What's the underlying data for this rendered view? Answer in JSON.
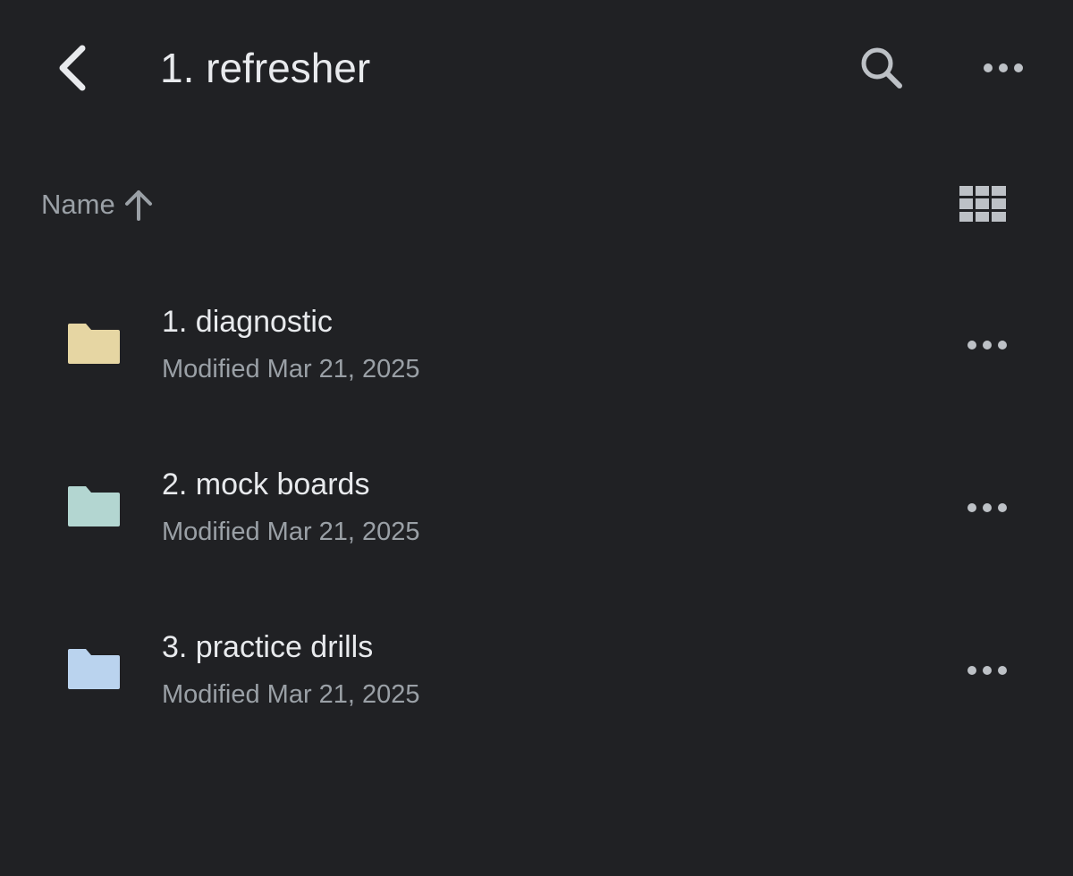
{
  "app_bar": {
    "title": "1. refresher",
    "back_icon": "chevron-left-icon",
    "search_icon": "search-icon",
    "more_icon": "more-horizontal-icon"
  },
  "toolbar": {
    "sort_label": "Name",
    "sort_icon": "arrow-up-icon",
    "view_icon": "grid-view-icon"
  },
  "items": [
    {
      "name": "1. diagnostic",
      "meta": "Modified Mar 21, 2025",
      "folder_color": "#e6d6a3",
      "icon": "folder-icon"
    },
    {
      "name": "2. mock boards",
      "meta": "Modified Mar 21, 2025",
      "folder_color": "#b3d6d1",
      "icon": "folder-icon"
    },
    {
      "name": "3. practice drills",
      "meta": "Modified Mar 21, 2025",
      "folder_color": "#bad3ee",
      "icon": "folder-icon"
    }
  ],
  "colors": {
    "background": "#202124",
    "primary_text": "#e8eaed",
    "secondary_text": "#9aa0a6",
    "icon": "#bdc1c6"
  }
}
